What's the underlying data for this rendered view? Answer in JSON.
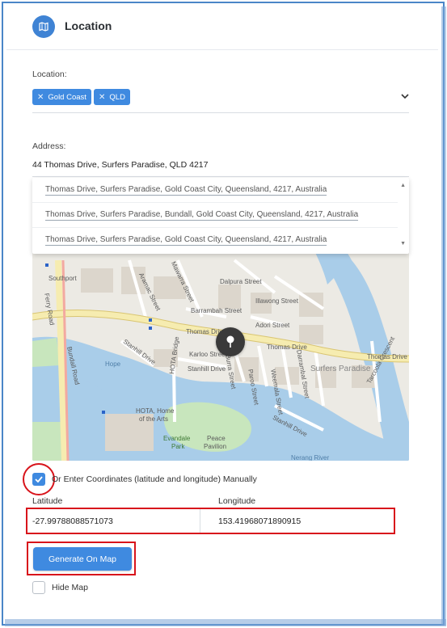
{
  "header": {
    "title": "Location",
    "icon": "map-icon"
  },
  "location": {
    "label": "Location:",
    "tags": [
      {
        "label": "Gold Coast"
      },
      {
        "label": "QLD"
      }
    ]
  },
  "address": {
    "label": "Address:",
    "value": "44 Thomas Drive, Surfers Paradise, QLD 4217",
    "suggestions": [
      "Thomas Drive, Surfers Paradise, Gold Coast City, Queensland, 4217, Australia",
      "Thomas Drive, Surfers Paradise, Bundall, Gold Coast City, Queensland, 4217, Australia",
      "Thomas Drive, Surfers Paradise, Gold Coast City, Queensland, 4217, Australia"
    ]
  },
  "map": {
    "labels": {
      "southport": "Southport",
      "mawarra": "Mawarra Street",
      "aramac": "Aramac Street",
      "dalpura": "Dalpura Street",
      "illawong": "Illawong Street",
      "barrambah": "Barrambah Street",
      "thomas1": "Thomas Drive",
      "thomas2": "Thomas Drive",
      "thomas3": "Thomas Drive",
      "adori": "Adori Street",
      "stanhill1": "Stanhill Drive",
      "stanhill2": "Stanhill Drive",
      "stanhill3": "Stanhill Drive",
      "karloo": "Karloo Street",
      "surfers": "Surfers Paradise",
      "ferry": "Ferry Road",
      "bundall": "Bundall Road",
      "hota_bridge": "HOTA Bridge",
      "hota": "HOTA, Home",
      "hota2": "of the Arts",
      "evandale": "Evandale",
      "evandale2": "Park",
      "peace": "Peace",
      "pavilion": "Pavilion",
      "nerang": "Nerang River",
      "hope": "Hope",
      "burra": "Burra Street",
      "darrambal": "Darrambal Street",
      "weemala": "Weemala Street",
      "paroo": "Paroo Street",
      "tarcoola": "Tarcoola Crescent"
    },
    "colors": {
      "land": "#eceae4",
      "water": "#a9cde9",
      "park": "#c8e6bd",
      "road_major": "#f6ecb0",
      "road_minor": "#ffffff"
    }
  },
  "manual": {
    "checked": true,
    "label": "Or Enter Coordinates (latitude and longitude) Manually"
  },
  "coords": {
    "lat_label": "Latitude",
    "lng_label": "Longitude",
    "lat": "-27.99788088571073",
    "lng": "153.41968071890915"
  },
  "generate_label": "Generate On Map",
  "hide_map": {
    "checked": false,
    "label": "Hide Map"
  },
  "accent": "#3f8ae0",
  "highlight": "#d8141b"
}
